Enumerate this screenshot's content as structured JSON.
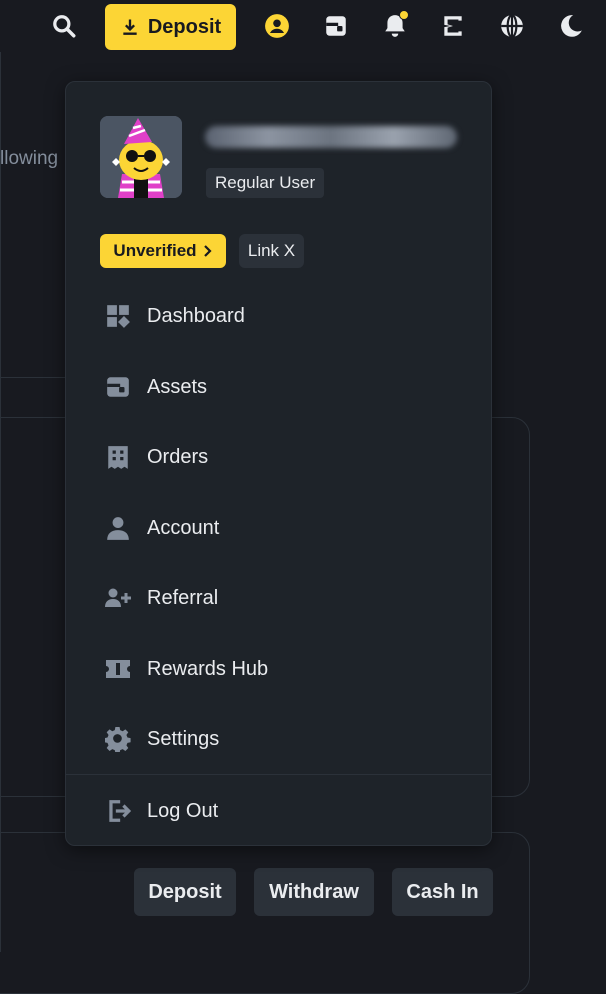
{
  "topbar": {
    "deposit_label": "Deposit",
    "icons": [
      "search-icon",
      "profile-icon",
      "wallet-icon",
      "bell-icon",
      "transfer-icon",
      "globe-icon",
      "moon-icon"
    ],
    "notification_dot": true
  },
  "background": {
    "partial_text": "llowing",
    "buttons": {
      "deposit": "Deposit",
      "withdraw": "Withdraw",
      "cash_in": "Cash In"
    }
  },
  "dropdown": {
    "user_type": "Regular User",
    "verification": "Unverified",
    "link": "Link X",
    "menu": [
      {
        "label": "Dashboard",
        "icon": "dashboard-icon"
      },
      {
        "label": "Assets",
        "icon": "wallet-icon"
      },
      {
        "label": "Orders",
        "icon": "receipt-icon"
      },
      {
        "label": "Account",
        "icon": "user-icon"
      },
      {
        "label": "Referral",
        "icon": "user-plus-icon"
      },
      {
        "label": "Rewards Hub",
        "icon": "ticket-icon"
      },
      {
        "label": "Settings",
        "icon": "gear-icon"
      }
    ],
    "logout": "Log Out"
  },
  "colors": {
    "accent": "#fcd535",
    "background": "#181a20",
    "panel": "#1e2329",
    "muted": "#2b3139",
    "icon": "#848e9c"
  }
}
